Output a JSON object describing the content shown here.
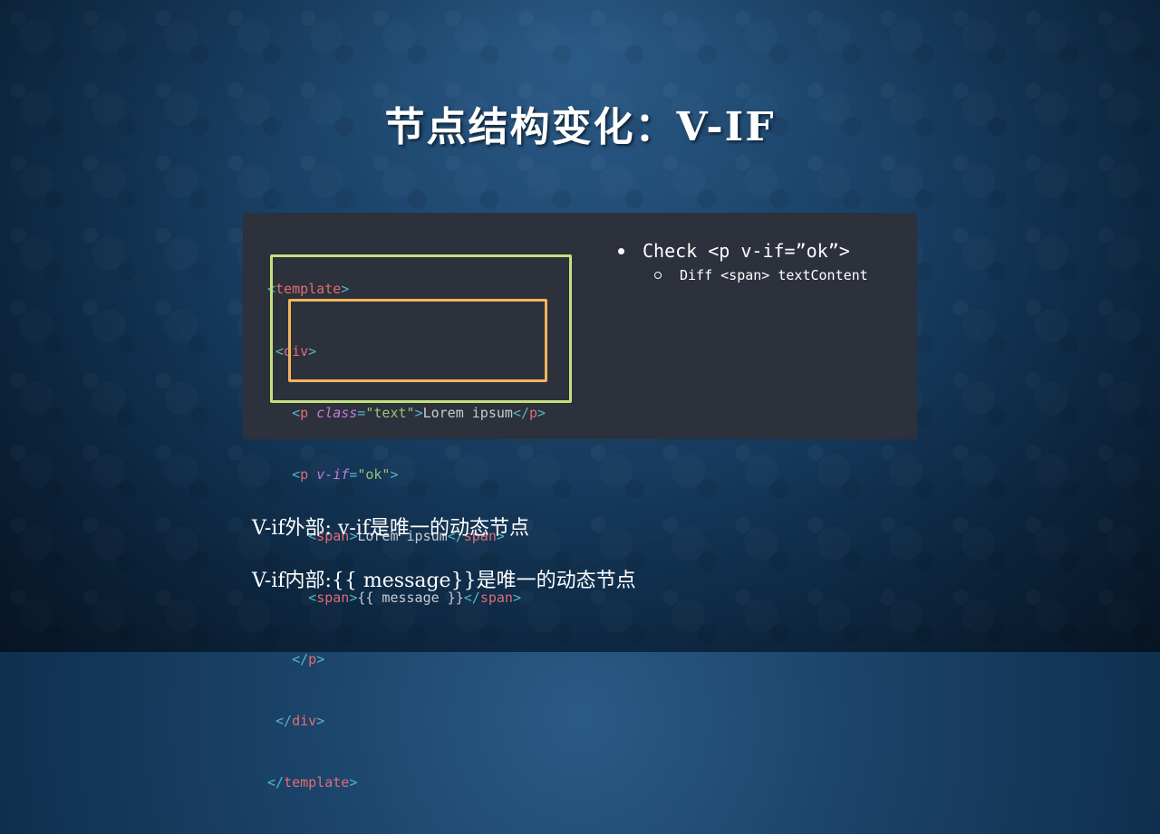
{
  "slide": {
    "title_cn": "节点结构变化：",
    "title_en": "V-IF"
  },
  "code": {
    "lines": [
      {
        "indent": "",
        "open": "<",
        "name": "template",
        "close": ">"
      },
      {
        "indent": " ",
        "open": "<",
        "name": "div",
        "close": ">"
      },
      {
        "indent": "   ",
        "p_open": "<",
        "p_name": "p",
        "attr": "class",
        "eq": "=",
        "val": "\"text\"",
        "gt": ">",
        "text": "Lorem ipsum",
        "end_open": "</",
        "end_name": "p",
        "end_close": ">"
      },
      {
        "indent": "   ",
        "open": "<",
        "name": "p",
        "attr": "v-if",
        "eq": "=",
        "val": "\"ok\"",
        "close": ">"
      },
      {
        "indent": "     ",
        "open": "<",
        "name": "span",
        "close": ">",
        "text": "Lorem ipsum",
        "end_open": "</",
        "end_name": "span",
        "end_close": ">"
      },
      {
        "indent": "     ",
        "open": "<",
        "name": "span",
        "close": ">",
        "text": "{{ message }}",
        "end_open": "</",
        "end_name": "span",
        "end_close": ">"
      },
      {
        "indent": "   ",
        "open": "</",
        "name": "p",
        "close": ">"
      },
      {
        "indent": " ",
        "open": "</",
        "name": "div",
        "close": ">"
      },
      {
        "indent": "",
        "open": "</",
        "name": "template",
        "close": ">"
      }
    ]
  },
  "notes": {
    "bullet_1": "Check <p v-if=”ok”>",
    "bullet_2": "Diff <span> textContent"
  },
  "body_lines": {
    "line1_a": "V-if",
    "line1_b": "外部: ",
    "line1_c": "v-if",
    "line1_d": "是唯一的动态节点",
    "line2_a": "V-if",
    "line2_b": "内部:",
    "line2_c": "{{ message}}",
    "line2_d": "是唯一的动态节点"
  }
}
